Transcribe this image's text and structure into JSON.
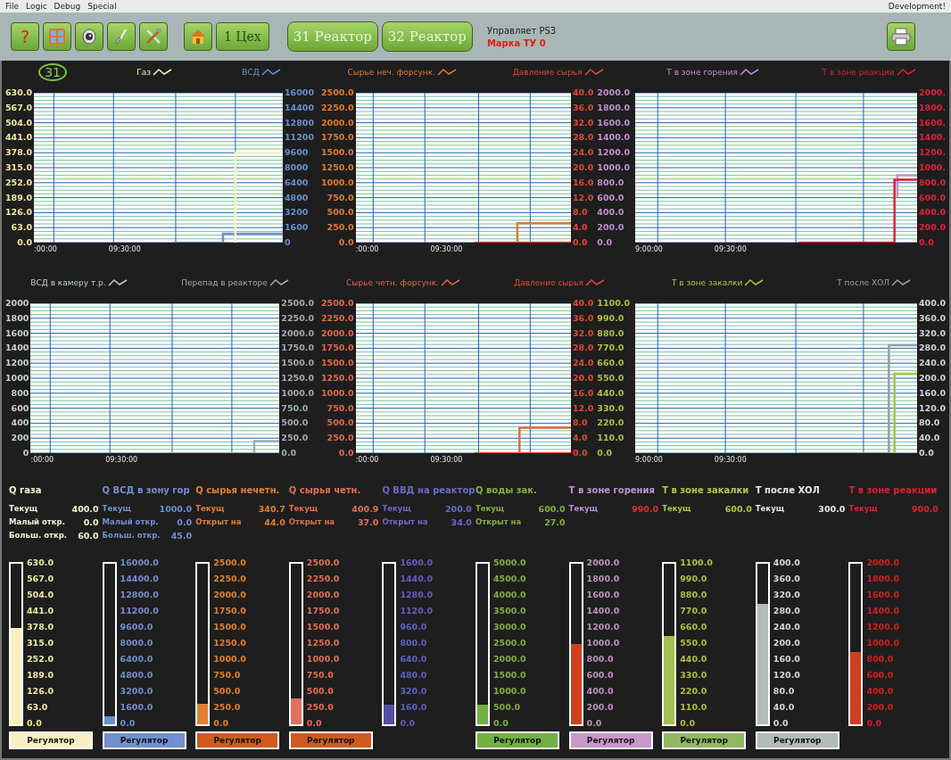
{
  "menu": [
    {
      "label": "File"
    },
    {
      "label": "Logic"
    },
    {
      "label": "Debug"
    },
    {
      "label": "Special"
    }
  ],
  "menu_right": "Development!",
  "toolbar": {
    "help": "?",
    "workshop": "1 Цех",
    "reactors": [
      {
        "label": "31 Реактор"
      },
      {
        "label": "32 Реактор"
      }
    ],
    "status": "Управляет PS3",
    "grade": "Марка ТУ 0"
  },
  "badge": "31",
  "charts": [
    {
      "legend": [
        {
          "label": "Газ",
          "color": "#f6f2c4"
        },
        {
          "label": "ВСД",
          "color": "#6a8fd0"
        }
      ],
      "left_axes": [
        {
          "color": "#f0e8a0",
          "ticks": [
            "630.0",
            "567.0",
            "504.0",
            "441.0",
            "378.0",
            "315.0",
            "252.0",
            "189.0",
            "126.0",
            "63.0",
            "0.0"
          ]
        }
      ],
      "right_axes": [
        {
          "color": "#6a8fd0",
          "ticks": [
            "16000",
            "14400",
            "12800",
            "11200",
            "9600",
            "8000",
            "6400",
            "4800",
            "3200",
            "1600",
            "0"
          ]
        }
      ],
      "x_labels": [
        ":00:00",
        "09:30:00"
      ]
    },
    {
      "legend": [
        {
          "label": "Сырье неч. форсунк.",
          "color": "#e07a30"
        },
        {
          "label": "Давление сырья",
          "color": "#e04a30"
        }
      ],
      "left_axes": [
        {
          "color": "#e07a30",
          "ticks": [
            "2500.0",
            "2250.0",
            "2000.0",
            "1750.0",
            "1500.0",
            "1250.0",
            "1000.0",
            "750.0",
            "500.0",
            "250.0",
            "0.0"
          ]
        }
      ],
      "right_axes": [
        {
          "color": "#e04a30",
          "ticks": [
            "40.0",
            "36.0",
            "32.0",
            "28.0",
            "24.0",
            "20.0",
            "16.0",
            "12.0",
            "8.0",
            "4.0",
            "0.0"
          ]
        },
        {
          "color": "#c090d0",
          "ticks": [
            "2000.0",
            "1800.0",
            "1600.0",
            "1400.0",
            "1200.0",
            "1000.0",
            "800.0",
            "600.0",
            "400.0",
            "200.0",
            "0.0"
          ]
        }
      ],
      "x_labels": [
        ":00:00",
        "09:30:00"
      ]
    },
    {
      "legend": [
        {
          "label": "Т в зоне горения",
          "color": "#c090d0"
        },
        {
          "label": "Т в зоне реакции",
          "color": "#e0203a"
        }
      ],
      "right_axes": [
        {
          "color": "#e0203a",
          "ticks": [
            "2000.",
            "1800.",
            "1600.",
            "1400.",
            "1200.",
            "1000.",
            "800.0",
            "600.0",
            "400.0",
            "200.0",
            "0.0"
          ]
        }
      ],
      "x_labels": [
        "9:00:00",
        "09:30:00"
      ]
    },
    {
      "legend": [
        {
          "label": "ВСД в камеру т.р.",
          "color": "#b8d0c8"
        },
        {
          "label": "Перепад в реакторе",
          "color": "#a0aab0"
        }
      ],
      "left_axes": [
        {
          "color": "#c8d0d0",
          "ticks": [
            "2000",
            "1800",
            "1600",
            "1400",
            "1200",
            "1000",
            "800",
            "600",
            "400",
            "200",
            "0"
          ]
        }
      ],
      "right_axes": [
        {
          "color": "#a0aab0",
          "ticks": [
            "2500.0",
            "2250.0",
            "2000.0",
            "1750.0",
            "1500.0",
            "1250.0",
            "1000.0",
            "750.0",
            "500.0",
            "250.0",
            "0.0"
          ]
        }
      ],
      "x_labels": [
        ":00:00",
        "09:30:00"
      ]
    },
    {
      "legend": [
        {
          "label": "Сырье четн. форсунк.",
          "color": "#e06a48"
        },
        {
          "label": "Давление сырья",
          "color": "#e04a30"
        }
      ],
      "left_axes": [
        {
          "color": "#e06a48",
          "ticks": [
            "2500.0",
            "2250.0",
            "2000.0",
            "1750.0",
            "1500.0",
            "1250.0",
            "1000.0",
            "750.0",
            "500.0",
            "250.0",
            "0.0"
          ]
        }
      ],
      "right_axes": [
        {
          "color": "#e04a30",
          "ticks": [
            "40.0",
            "36.0",
            "32.0",
            "28.0",
            "24.0",
            "20.0",
            "16.0",
            "12.0",
            "8.0",
            "4.0",
            "0.0"
          ]
        },
        {
          "color": "#b0c040",
          "ticks": [
            "1100.0",
            "990.0",
            "880.0",
            "770.0",
            "660.0",
            "550.0",
            "440.0",
            "330.0",
            "220.0",
            "110.0",
            "0.0"
          ]
        }
      ],
      "x_labels": [
        ":00:00",
        "09:30:00"
      ]
    },
    {
      "legend": [
        {
          "label": "Т в зоне закалки",
          "color": "#a0c840"
        },
        {
          "label": "Т после ХОЛ",
          "color": "#90a0a8"
        }
      ],
      "right_axes": [
        {
          "color": "#d0d4d4",
          "ticks": [
            "400.0",
            "360.0",
            "320.0",
            "280.0",
            "240.0",
            "200.0",
            "160.0",
            "120.0",
            "80.0",
            "40.0",
            "0.0"
          ]
        }
      ],
      "x_labels": [
        "9:00:00",
        "09:30:00"
      ]
    }
  ],
  "readouts": [
    {
      "title": "Q газа",
      "color": "#f4f0d0",
      "rows": [
        {
          "label": "Текущ",
          "value": "400.0"
        },
        {
          "label": "Малый откр.",
          "value": "0.0"
        },
        {
          "label": "Больш. откр.",
          "value": "60.0"
        }
      ]
    },
    {
      "title": "Q ВСД в зону гор",
      "color": "#7090d0",
      "rows": [
        {
          "label": "Текущ",
          "value": "1000.0"
        },
        {
          "label": "Малый откр.",
          "value": "0.0"
        },
        {
          "label": "Больш. откр.",
          "value": "45.0"
        }
      ]
    },
    {
      "title": "Q сырья нечетн.",
      "color": "#e08030",
      "rows": [
        {
          "label": "Текущ",
          "value": "340.7"
        },
        {
          "label": "Открыт на",
          "value": "44.0"
        }
      ]
    },
    {
      "title": "Q сырья четн.",
      "color": "#e07050",
      "rows": [
        {
          "label": "Текущ",
          "value": "400.9"
        },
        {
          "label": "Открыт на",
          "value": "37.0"
        }
      ]
    },
    {
      "title": "Q ВВД на реактор",
      "color": "#6a6ac8",
      "rows": [
        {
          "label": "Текущ",
          "value": "200.0"
        },
        {
          "label": "Открыт на",
          "value": "34.0"
        }
      ]
    },
    {
      "title": "Q воды зак.",
      "color": "#80b040",
      "rows": [
        {
          "label": "Текущ",
          "value": "600.0"
        },
        {
          "label": "Открыт на",
          "value": "27.0"
        }
      ]
    },
    {
      "title": "Т в зоне горения",
      "color": "#c090d0",
      "rows": [
        {
          "label": "Текущ",
          "value": "990.0",
          "color": "#e03030"
        }
      ]
    },
    {
      "title": "Т в зоне закалки",
      "color": "#b0c840",
      "rows": [
        {
          "label": "Текущ",
          "value": "600.0"
        }
      ]
    },
    {
      "title": "Т после ХОЛ",
      "color": "#e8e8e8",
      "rows": [
        {
          "label": "Текущ",
          "value": "300.0"
        }
      ]
    },
    {
      "title": "Т в зоне реакции",
      "color": "#e02030",
      "rows": [
        {
          "label": "Текущ",
          "value": "900.0"
        }
      ]
    }
  ],
  "gauges": [
    {
      "color": "#f8f0c0",
      "level": 0.6,
      "scale": {
        "color": "#f0e8a0",
        "ticks": [
          "630.0",
          "567.0",
          "504.0",
          "441.0",
          "378.0",
          "315.0",
          "252.0",
          "189.0",
          "126.0",
          "63.0",
          "0.0"
        ]
      },
      "button": {
        "label": "Регулятор",
        "color": "#f8f0c0"
      }
    },
    {
      "color": "#6a8fd0",
      "level": 0.05,
      "scale": {
        "color": "#7090d0",
        "ticks": [
          "16000.0",
          "14400.0",
          "12800.0",
          "11200.0",
          "9600.0",
          "8000.0",
          "6400.0",
          "4800.0",
          "3200.0",
          "1600.0",
          "0.0"
        ]
      },
      "button": {
        "label": "Регулятор",
        "color": "#7090d0"
      }
    },
    {
      "color": "#e08030",
      "level": 0.13,
      "scale": {
        "color": "#e08030",
        "ticks": [
          "2500.0",
          "2250.0",
          "2000.0",
          "1750.0",
          "1500.0",
          "1250.0",
          "1000.0",
          "750.0",
          "500.0",
          "250.0",
          "0.0"
        ]
      },
      "button": {
        "label": "Регулятор",
        "color": "#d05a20"
      }
    },
    {
      "color": "#e07060",
      "level": 0.16,
      "scale": {
        "color": "#e07050",
        "ticks": [
          "2500.0",
          "2250.0",
          "2000.0",
          "1750.0",
          "1500.0",
          "1250.0",
          "1000.0",
          "750.0",
          "500.0",
          "250.0",
          "0.0"
        ]
      },
      "button": {
        "label": "Регулятор",
        "color": "#d05a20"
      }
    },
    {
      "color": "#5050a0",
      "level": 0.12,
      "scale": {
        "color": "#6060c0",
        "ticks": [
          "1600.0",
          "1440.0",
          "1280.0",
          "1120.0",
          "960.0",
          "800.0",
          "640.0",
          "480.0",
          "320.0",
          "160.0",
          "0.0"
        ]
      }
    },
    {
      "color": "#70b040",
      "level": 0.12,
      "scale": {
        "color": "#80b040",
        "ticks": [
          "5000.0",
          "4500.0",
          "4000.0",
          "3500.0",
          "3000.0",
          "2500.0",
          "2000.0",
          "1500.0",
          "1000.0",
          "500.0",
          "0.0"
        ]
      },
      "button": {
        "label": "Регулятор",
        "color": "#70b040"
      }
    },
    {
      "color": "#d04020",
      "level": 0.5,
      "scale": {
        "color": "#c090c0",
        "ticks": [
          "2000.0",
          "1800.0",
          "1600.0",
          "1400.0",
          "1200.0",
          "1000.0",
          "800.0",
          "600.0",
          "400.0",
          "200.0",
          "0.0"
        ]
      },
      "button": {
        "label": "Регулятор",
        "color": "#c898c8"
      }
    },
    {
      "color": "#a0c050",
      "level": 0.55,
      "scale": {
        "color": "#b0c040",
        "ticks": [
          "1100.0",
          "990.0",
          "880.0",
          "770.0",
          "660.0",
          "550.0",
          "440.0",
          "330.0",
          "220.0",
          "110.0",
          "0.0"
        ]
      },
      "button": {
        "label": "Регулятор",
        "color": "#90b860"
      }
    },
    {
      "color": "#b0bcb8",
      "level": 0.75,
      "scale": {
        "color": "#d8d8d8",
        "ticks": [
          "400.0",
          "360.0",
          "320.0",
          "280.0",
          "240.0",
          "200.0",
          "160.0",
          "120.0",
          "80.0",
          "40.0",
          "0.0"
        ]
      },
      "button": {
        "label": "Регулятор",
        "color": "#b0bcb8"
      }
    },
    {
      "color": "#d04020",
      "level": 0.45,
      "scale": {
        "color": "#d02020",
        "ticks": [
          "2000.0",
          "1800.0",
          "1600.0",
          "1400.0",
          "1200.0",
          "1000.0",
          "800.0",
          "600.0",
          "400.0",
          "200.0",
          "0.0"
        ]
      }
    }
  ]
}
